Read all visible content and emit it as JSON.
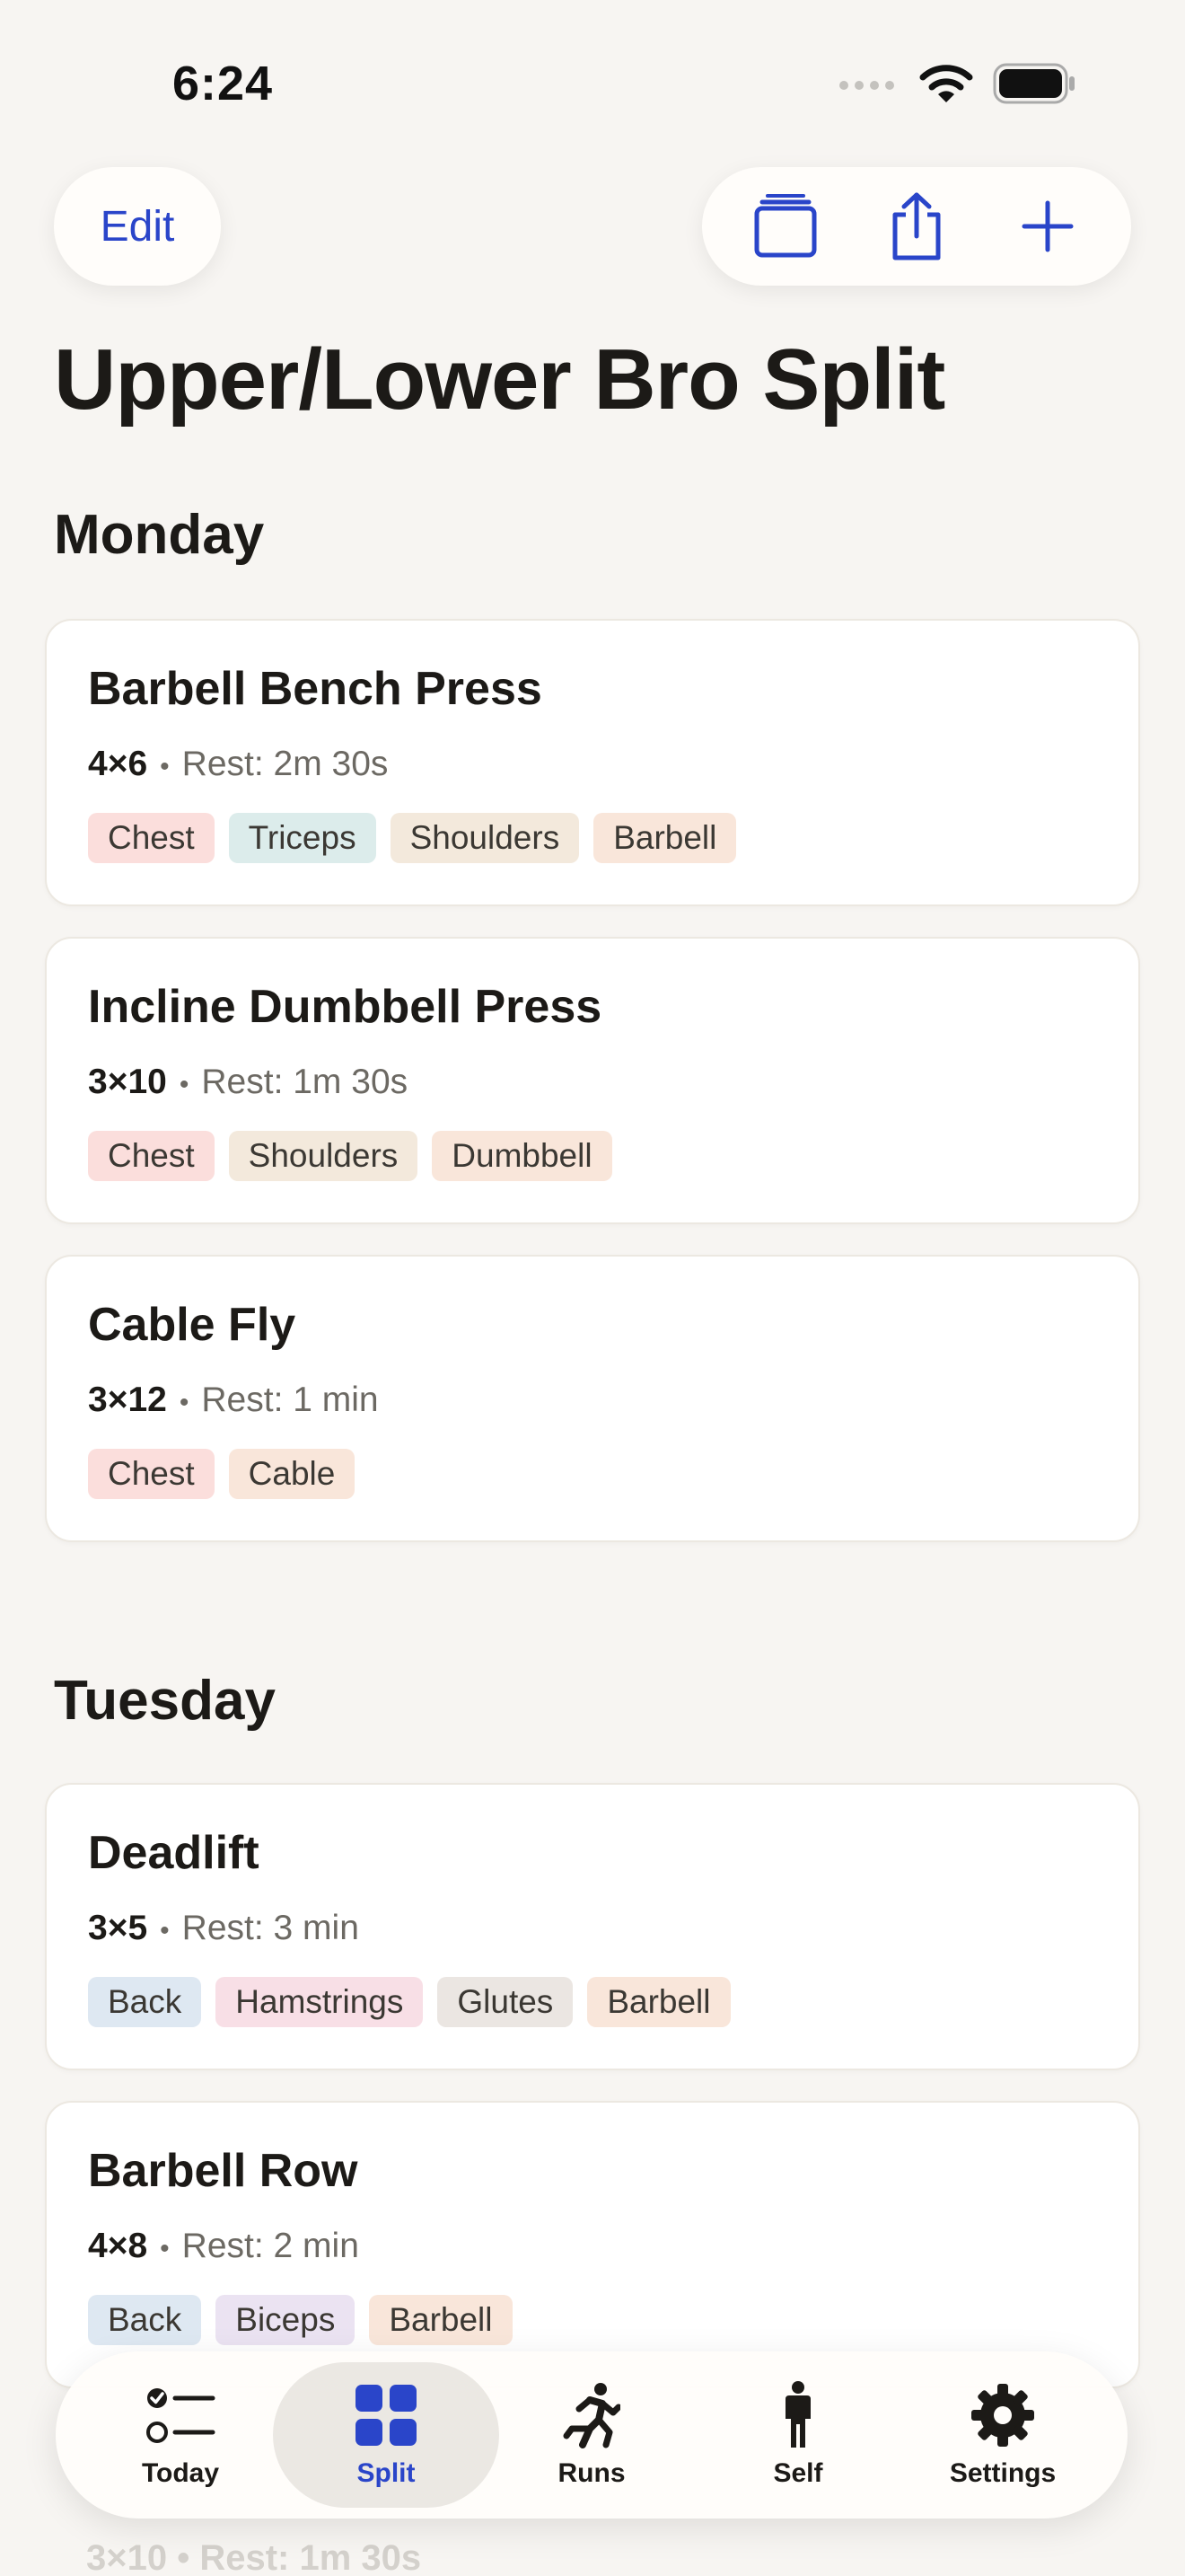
{
  "status": {
    "time": "6:24"
  },
  "nav": {
    "edit_label": "Edit",
    "actions": [
      "stack-icon",
      "share-icon",
      "plus-icon"
    ]
  },
  "title": "Upper/Lower Bro Split",
  "days": [
    {
      "name": "Monday",
      "exercises": [
        {
          "name": "Barbell Bench Press",
          "sets": "4×6",
          "rest": "Rest: 2m 30s",
          "tags": [
            {
              "label": "Chest",
              "color": "#fbdedc"
            },
            {
              "label": "Triceps",
              "color": "#dceceb"
            },
            {
              "label": "Shoulders",
              "color": "#f3e9dc"
            },
            {
              "label": "Barbell",
              "color": "#f9e6da"
            }
          ]
        },
        {
          "name": "Incline Dumbbell Press",
          "sets": "3×10",
          "rest": "Rest: 1m 30s",
          "tags": [
            {
              "label": "Chest",
              "color": "#fbdedc"
            },
            {
              "label": "Shoulders",
              "color": "#f3e9dc"
            },
            {
              "label": "Dumbbell",
              "color": "#f9e6da"
            }
          ]
        },
        {
          "name": "Cable Fly",
          "sets": "3×12",
          "rest": "Rest: 1 min",
          "tags": [
            {
              "label": "Chest",
              "color": "#fbdedc"
            },
            {
              "label": "Cable",
              "color": "#f9e6da"
            }
          ]
        }
      ]
    },
    {
      "name": "Tuesday",
      "exercises": [
        {
          "name": "Deadlift",
          "sets": "3×5",
          "rest": "Rest: 3 min",
          "tags": [
            {
              "label": "Back",
              "color": "#dee8f2"
            },
            {
              "label": "Hamstrings",
              "color": "#f8dfe6"
            },
            {
              "label": "Glutes",
              "color": "#ebe6e2"
            },
            {
              "label": "Barbell",
              "color": "#f9e6da"
            }
          ]
        },
        {
          "name": "Barbell Row",
          "sets": "4×8",
          "rest": "Rest: 2 min",
          "tags": [
            {
              "label": "Back",
              "color": "#dee8f2"
            },
            {
              "label": "Biceps",
              "color": "#ebe3f2"
            },
            {
              "label": "Barbell",
              "color": "#f9e6da"
            }
          ]
        }
      ]
    }
  ],
  "peek": {
    "sets": "3×10",
    "rest": "Rest: 1m 30s"
  },
  "tabs": [
    {
      "label": "Today",
      "icon": "checklist-icon",
      "active": false
    },
    {
      "label": "Split",
      "icon": "grid-icon",
      "active": true
    },
    {
      "label": "Runs",
      "icon": "runner-icon",
      "active": false
    },
    {
      "label": "Self",
      "icon": "person-icon",
      "active": false
    },
    {
      "label": "Settings",
      "icon": "gear-icon",
      "active": false
    }
  ],
  "colors": {
    "accent": "#2a45c9",
    "background": "#f7f5f2"
  }
}
